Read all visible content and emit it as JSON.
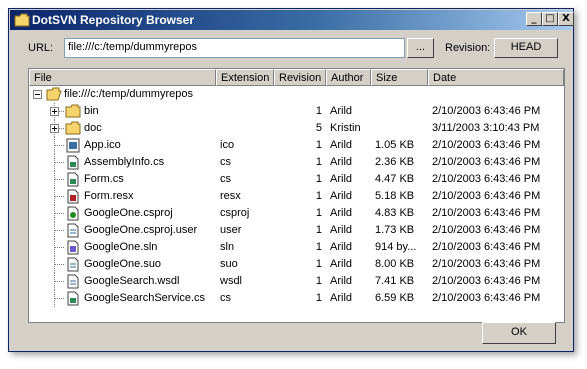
{
  "window": {
    "title": "DotSVN Repository Browser",
    "controls": {
      "minimize": "_",
      "maximize": "□",
      "close": "X"
    }
  },
  "url": {
    "label": "URL:",
    "value": "file:///c:/temp/dummyrepos",
    "browse_label": "...",
    "revision_label": "Revision:",
    "revision_button": "HEAD"
  },
  "columns": [
    "File",
    "Extension",
    "Revision",
    "Author",
    "Size",
    "Date"
  ],
  "root": {
    "name": "file:///c:/temp/dummyrepos",
    "icon": "folder-open-icon"
  },
  "rows": [
    {
      "name": "bin",
      "ext": "",
      "rev": "1",
      "author": "Arild",
      "size": "",
      "date": "2/10/2003 6:43:46 PM",
      "icon": "folder-icon",
      "folder": true
    },
    {
      "name": "doc",
      "ext": "",
      "rev": "5",
      "author": "Kristin",
      "size": "",
      "date": "3/11/2003 3:10:43 PM",
      "icon": "folder-icon",
      "folder": true
    },
    {
      "name": "App.ico",
      "ext": "ico",
      "rev": "1",
      "author": "Arild",
      "size": "1.05 KB",
      "date": "2/10/2003 6:43:46 PM",
      "icon": "image-file-icon",
      "folder": false
    },
    {
      "name": "AssemblyInfo.cs",
      "ext": "cs",
      "rev": "1",
      "author": "Arild",
      "size": "2.36 KB",
      "date": "2/10/2003 6:43:46 PM",
      "icon": "csharp-file-icon",
      "folder": false
    },
    {
      "name": "Form.cs",
      "ext": "cs",
      "rev": "1",
      "author": "Arild",
      "size": "4.47 KB",
      "date": "2/10/2003 6:43:46 PM",
      "icon": "csharp-file-icon",
      "folder": false
    },
    {
      "name": "Form.resx",
      "ext": "resx",
      "rev": "1",
      "author": "Arild",
      "size": "5.18 KB",
      "date": "2/10/2003 6:43:46 PM",
      "icon": "resx-file-icon",
      "folder": false
    },
    {
      "name": "GoogleOne.csproj",
      "ext": "csproj",
      "rev": "1",
      "author": "Arild",
      "size": "4.83 KB",
      "date": "2/10/2003 6:43:46 PM",
      "icon": "project-file-icon",
      "folder": false
    },
    {
      "name": "GoogleOne.csproj.user",
      "ext": "user",
      "rev": "1",
      "author": "Arild",
      "size": "1.73 KB",
      "date": "2/10/2003 6:43:46 PM",
      "icon": "document-file-icon",
      "folder": false
    },
    {
      "name": "GoogleOne.sln",
      "ext": "sln",
      "rev": "1",
      "author": "Arild",
      "size": "914 by...",
      "date": "2/10/2003 6:43:46 PM",
      "icon": "solution-file-icon",
      "folder": false
    },
    {
      "name": "GoogleOne.suo",
      "ext": "suo",
      "rev": "1",
      "author": "Arild",
      "size": "8.00 KB",
      "date": "2/10/2003 6:43:46 PM",
      "icon": "document-file-icon",
      "folder": false
    },
    {
      "name": "GoogleSearch.wsdl",
      "ext": "wsdl",
      "rev": "1",
      "author": "Arild",
      "size": "7.41 KB",
      "date": "2/10/2003 6:43:46 PM",
      "icon": "document-file-icon",
      "folder": false
    },
    {
      "name": "GoogleSearchService.cs",
      "ext": "cs",
      "rev": "1",
      "author": "Arild",
      "size": "6.59 KB",
      "date": "2/10/2003 6:43:46 PM",
      "icon": "csharp-file-icon",
      "folder": false
    }
  ],
  "ok_label": "OK",
  "colors": {
    "titlebar_start": "#0a246a",
    "titlebar_end": "#a6caf0",
    "face": "#d4d0c8",
    "folder": "#f5d46b"
  }
}
